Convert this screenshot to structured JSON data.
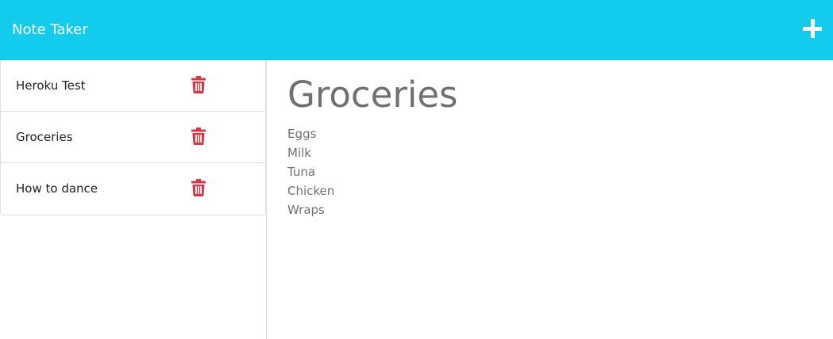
{
  "app": {
    "title": "Note Taker",
    "add_icon": "plus-icon",
    "accent_color": "#12cbed",
    "delete_color": "#dc3545"
  },
  "notes": [
    {
      "title": "Heroku Test",
      "delete_icon": "trash-icon"
    },
    {
      "title": "Groceries",
      "delete_icon": "trash-icon"
    },
    {
      "title": "How to dance",
      "delete_icon": "trash-icon"
    }
  ],
  "active_note": {
    "title": "Groceries",
    "lines": [
      "Eggs",
      "Milk",
      "Tuna",
      "Chicken",
      "Wraps"
    ]
  }
}
